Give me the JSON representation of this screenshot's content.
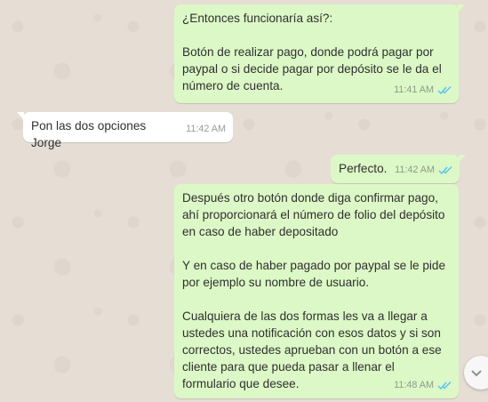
{
  "messages": [
    {
      "text": "¿Entonces funcionaría así?:\n\nBotón de realizar pago, donde podrá pagar por paypal o si decide pagar por depósito se le da el número de cuenta.",
      "time": "11:41 AM"
    },
    {
      "text": "Pon las dos opciones Jorge",
      "time": "11:42 AM"
    },
    {
      "text": "Perfecto.",
      "time": "11:42 AM"
    },
    {
      "text": "Después otro botón donde diga confirmar pago, ahí proporcionará el número de folio del depósito en caso de haber depositado\n\nY en caso de haber pagado por paypal se le pide por ejemplo su nombre de usuario.\n\nCualquiera de las dos formas les va a llegar a ustedes una notificación con esos datos y si son correctos, ustedes aprueban con un botón a ese cliente para que pueda pasar a llenar el formulario que desee.",
      "time": "11:48 AM"
    }
  ],
  "colors": {
    "outgoing_bubble": "#dcf8c6",
    "incoming_bubble": "#ffffff",
    "read_ticks": "#4fc3f7",
    "wallpaper": "#e6ddd4"
  },
  "icons": {
    "read_receipt": "double-check-icon",
    "scroll_down": "chevron-down-icon"
  }
}
